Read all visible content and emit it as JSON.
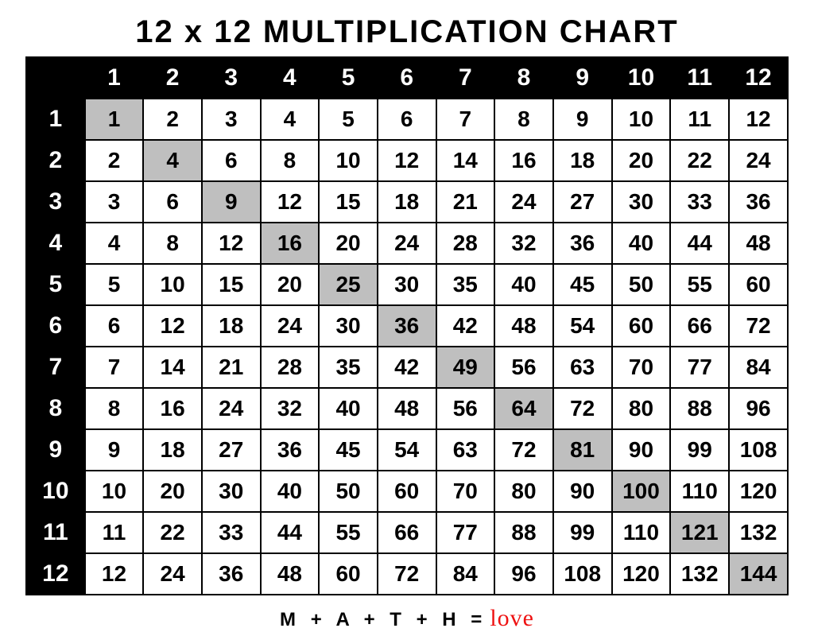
{
  "title": "12 x 12 MULTIPLICATION CHART",
  "footer": {
    "math": "M + A + T + H =",
    "love": "love"
  },
  "chart_data": {
    "type": "table",
    "size": 12,
    "col_headers": [
      1,
      2,
      3,
      4,
      5,
      6,
      7,
      8,
      9,
      10,
      11,
      12
    ],
    "row_headers": [
      1,
      2,
      3,
      4,
      5,
      6,
      7,
      8,
      9,
      10,
      11,
      12
    ],
    "values": [
      [
        1,
        2,
        3,
        4,
        5,
        6,
        7,
        8,
        9,
        10,
        11,
        12
      ],
      [
        2,
        4,
        6,
        8,
        10,
        12,
        14,
        16,
        18,
        20,
        22,
        24
      ],
      [
        3,
        6,
        9,
        12,
        15,
        18,
        21,
        24,
        27,
        30,
        33,
        36
      ],
      [
        4,
        8,
        12,
        16,
        20,
        24,
        28,
        32,
        36,
        40,
        44,
        48
      ],
      [
        5,
        10,
        15,
        20,
        25,
        30,
        35,
        40,
        45,
        50,
        55,
        60
      ],
      [
        6,
        12,
        18,
        24,
        30,
        36,
        42,
        48,
        54,
        60,
        66,
        72
      ],
      [
        7,
        14,
        21,
        28,
        35,
        42,
        49,
        56,
        63,
        70,
        77,
        84
      ],
      [
        8,
        16,
        24,
        32,
        40,
        48,
        56,
        64,
        72,
        80,
        88,
        96
      ],
      [
        9,
        18,
        27,
        36,
        45,
        54,
        63,
        72,
        81,
        90,
        99,
        108
      ],
      [
        10,
        20,
        30,
        40,
        50,
        60,
        70,
        80,
        90,
        100,
        110,
        120
      ],
      [
        11,
        22,
        33,
        44,
        55,
        66,
        77,
        88,
        99,
        110,
        121,
        132
      ],
      [
        12,
        24,
        36,
        48,
        60,
        72,
        84,
        96,
        108,
        120,
        132,
        144
      ]
    ],
    "highlight_diagonal": true
  }
}
